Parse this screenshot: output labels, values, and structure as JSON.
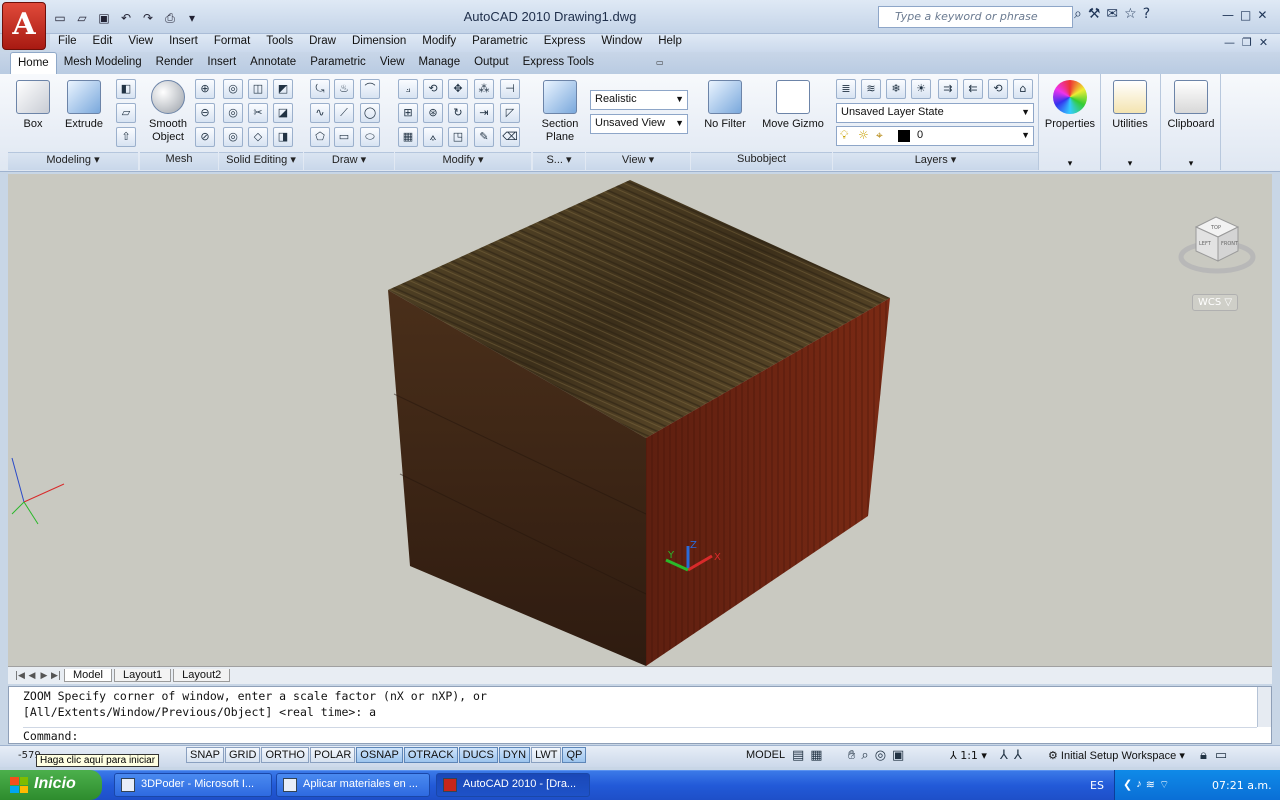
{
  "window": {
    "app_logo": "A",
    "title": "AutoCAD 2010   Drawing1.dwg",
    "search_placeholder": "Type a keyword or phrase"
  },
  "menu": [
    "File",
    "Edit",
    "View",
    "Insert",
    "Format",
    "Tools",
    "Draw",
    "Dimension",
    "Modify",
    "Parametric",
    "Express",
    "Window",
    "Help"
  ],
  "ribbon_tabs": [
    "Home",
    "Mesh Modeling",
    "Render",
    "Insert",
    "Annotate",
    "Parametric",
    "View",
    "Manage",
    "Output",
    "Express Tools"
  ],
  "ribbon": {
    "box": "Box",
    "extrude": "Extrude",
    "smooth_object": "Smooth Object",
    "section_plane": "Section Plane",
    "visual_style": "Realistic",
    "view_saved": "Unsaved View",
    "no_filter": "No Filter",
    "move_gizmo": "Move Gizmo",
    "layer_state": "Unsaved Layer State",
    "layer_current": "0",
    "properties": "Properties",
    "utilities": "Utilities",
    "clipboard": "Clipboard",
    "panels": {
      "modeling": "Modeling",
      "mesh": "Mesh",
      "solid_editing": "Solid Editing",
      "draw": "Draw",
      "modify": "Modify",
      "section": "S...",
      "view": "View",
      "subobject": "Subobject",
      "layers": "Layers"
    }
  },
  "viewport": {
    "wcs": "WCS",
    "ucs_labels": {
      "x": "X",
      "y": "Y",
      "z": "Z"
    },
    "viewcube": {
      "top": "TOP",
      "left": "LEFT",
      "front": "FRONT"
    }
  },
  "layout_tabs": [
    "Model",
    "Layout1",
    "Layout2"
  ],
  "command": {
    "line1": "ZOOM Specify corner of window, enter a scale factor (nX or nXP), or",
    "line2": "[All/Extents/Window/Previous/Object] <real time>: a",
    "prompt": "Command:"
  },
  "status": {
    "coords": "-579.",
    "tooltip": "Haga clic aquí para iniciar",
    "toggles": [
      {
        "label": "SNAP",
        "on": false
      },
      {
        "label": "GRID",
        "on": false
      },
      {
        "label": "ORTHO",
        "on": false
      },
      {
        "label": "POLAR",
        "on": false
      },
      {
        "label": "OSNAP",
        "on": true
      },
      {
        "label": "OTRACK",
        "on": true
      },
      {
        "label": "DUCS",
        "on": true
      },
      {
        "label": "DYN",
        "on": true
      },
      {
        "label": "LWT",
        "on": false
      },
      {
        "label": "QP",
        "on": true
      }
    ],
    "model": "MODEL",
    "scale": "1:1",
    "workspace": "Initial Setup Workspace"
  },
  "taskbar": {
    "start": "Inicio",
    "tasks": [
      "3DPoder - Microsoft I...",
      "Aplicar materiales en ...",
      "AutoCAD 2010 - [Dra..."
    ],
    "lang": "ES",
    "clock": "07:21 a.m."
  }
}
